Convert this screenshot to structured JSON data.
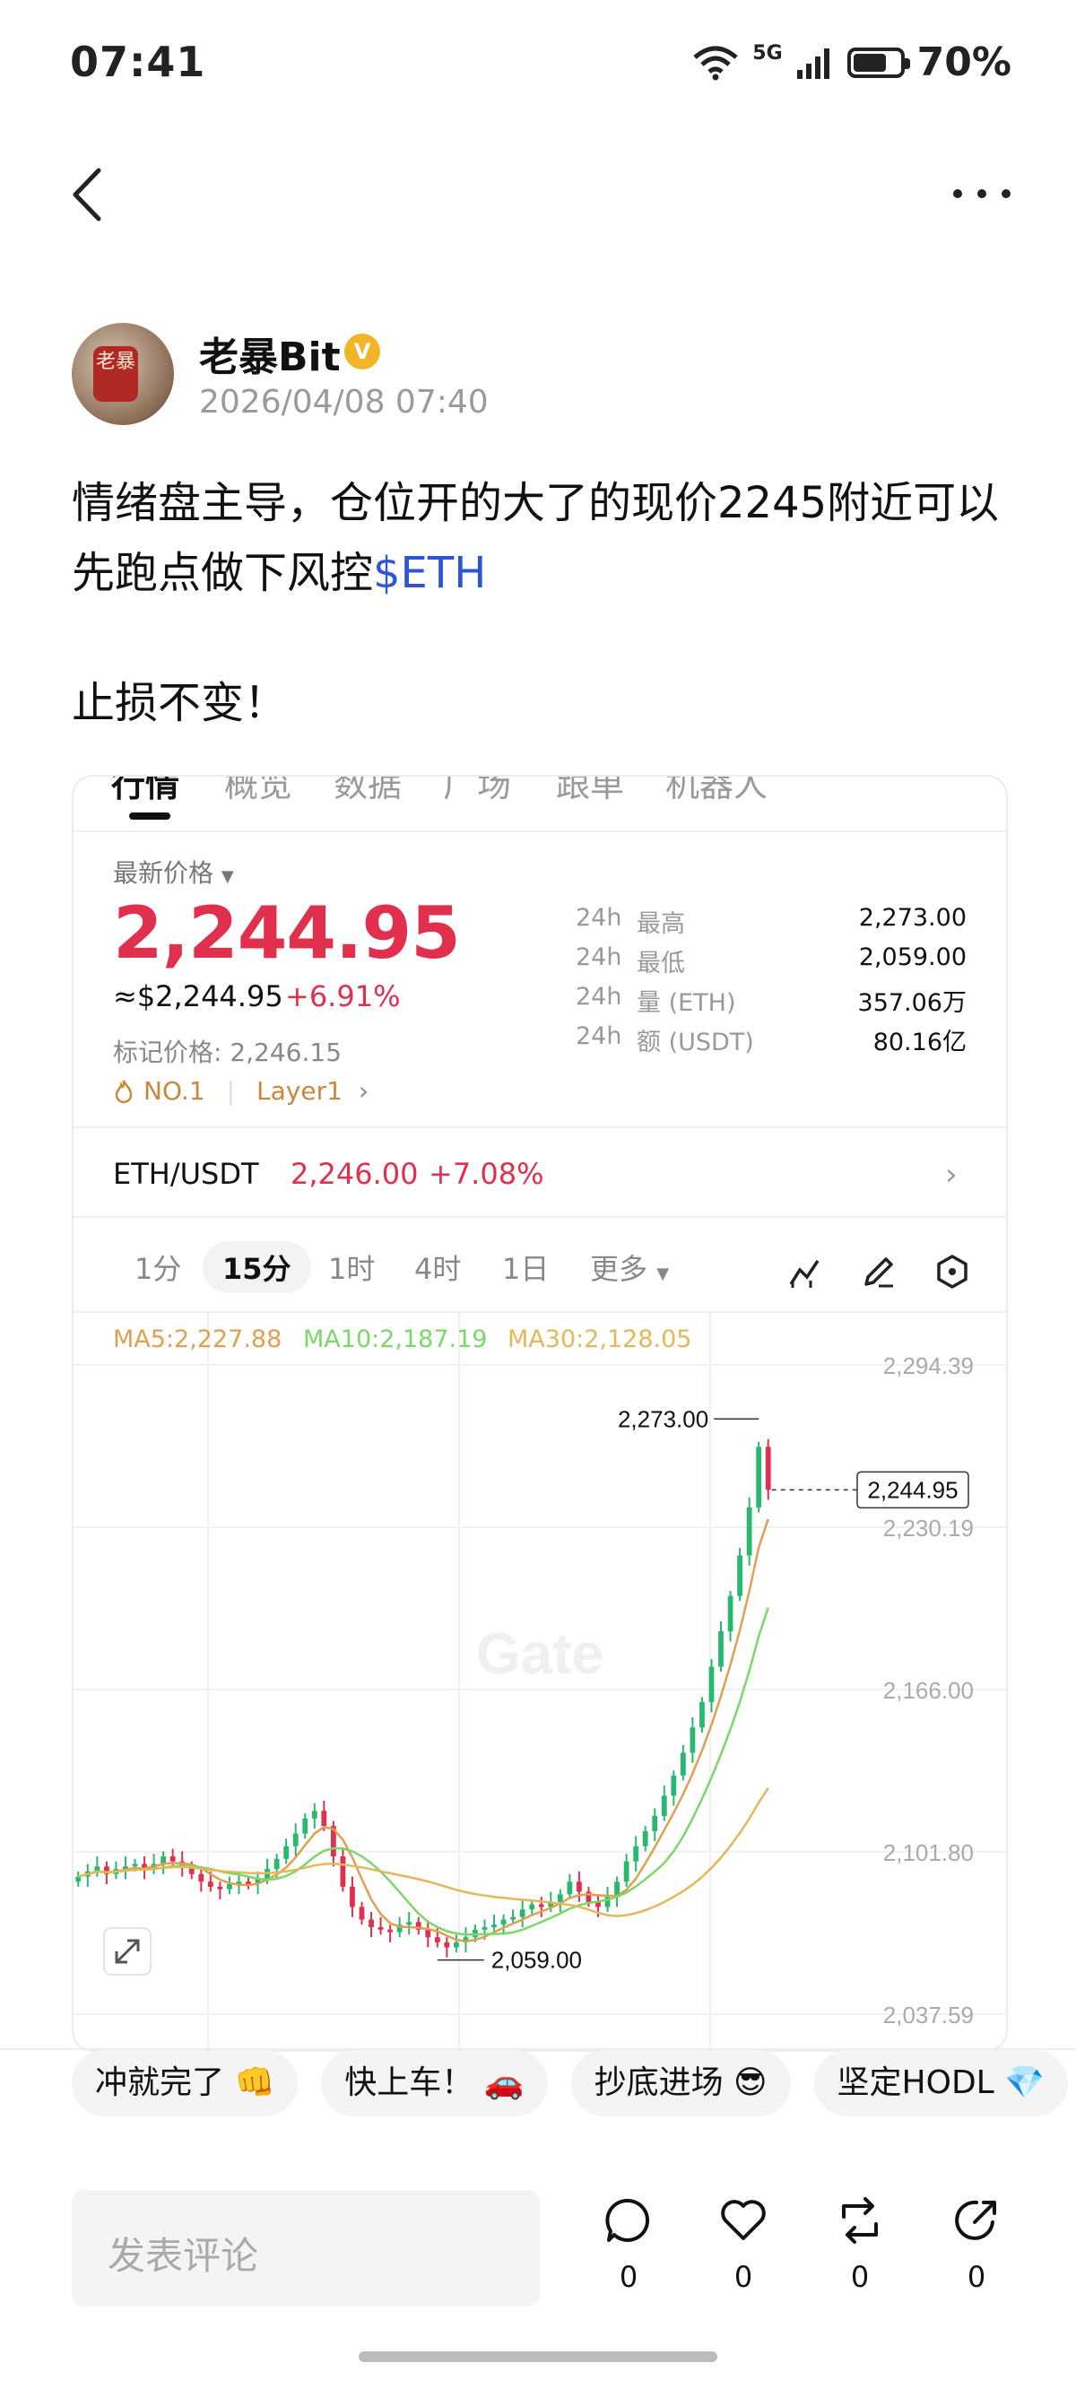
{
  "status_bar": {
    "time": "07:41",
    "signal_label": "5G",
    "battery_text": "70%",
    "battery_level": 0.7
  },
  "author": {
    "name": "老暴Bit",
    "avatar_text": "老暴",
    "timestamp": "2026/04/08 07:40",
    "verified_mark": "V"
  },
  "post": {
    "line1": "情绪盘主导，仓位开的大了的现价2245附近可以",
    "line2": "先跑点做下风控",
    "tag": "$ETH",
    "line3": "止损不变！"
  },
  "card": {
    "tabs": [
      "行情",
      "概览",
      "数据",
      "广场",
      "跟单",
      "机器人"
    ],
    "latest_label": "最新价格",
    "price": "2,244.95",
    "usd_price": "≈$2,244.95",
    "change_pct": "+6.91%",
    "mark_price": "标记价格: 2,246.15",
    "rank": "NO.1",
    "category": "Layer1",
    "stats": [
      {
        "k1": "24h",
        "k2": "最高",
        "v": "2,273.00"
      },
      {
        "k1": "24h",
        "k2": "最低",
        "v": "2,059.00"
      },
      {
        "k1": "24h",
        "k2": "量 (ETH)",
        "v": "357.06万"
      },
      {
        "k1": "24h",
        "k2": "额 (USDT)",
        "v": "80.16亿"
      }
    ],
    "pair": "ETH/USDT",
    "pair_price": "2,246.00",
    "pair_change": "+7.08%",
    "intervals": [
      "1分",
      "15分",
      "1时",
      "4时",
      "1日",
      "更多"
    ],
    "active_interval": "15分"
  },
  "chart_data": {
    "type": "candlestick",
    "ma_labels": [
      "MA5:2,227.88",
      "MA10:2,187.19",
      "MA30:2,128.05"
    ],
    "y_ticks": [
      "2,294.39",
      "2,230.19",
      "2,166.00",
      "2,101.80",
      "2,037.59"
    ],
    "ylim": [
      2037.59,
      2294.39
    ],
    "high_label": "2,273.00",
    "low_label": "2,059.00",
    "current_label": "2,244.95",
    "watermark": "Gate",
    "colors": {
      "up": "#28b870",
      "down": "#e0304e",
      "ma5": "#e0a050",
      "ma10": "#7ad86a",
      "ma30": "#e2b85a"
    },
    "close": [
      2092,
      2094,
      2096,
      2093,
      2095,
      2096,
      2097,
      2095,
      2097,
      2100,
      2098,
      2096,
      2093,
      2090,
      2088,
      2087,
      2089,
      2090,
      2089,
      2091,
      2095,
      2099,
      2104,
      2109,
      2115,
      2118,
      2112,
      2100,
      2088,
      2080,
      2075,
      2072,
      2071,
      2070,
      2073,
      2074,
      2071,
      2068,
      2066,
      2064,
      2066,
      2068,
      2071,
      2072,
      2073,
      2075,
      2076,
      2079,
      2081,
      2080,
      2082,
      2085,
      2090,
      2086,
      2082,
      2080,
      2084,
      2090,
      2098,
      2104,
      2110,
      2116,
      2124,
      2132,
      2141,
      2151,
      2161,
      2175,
      2189,
      2203,
      2219,
      2238,
      2262,
      2245
    ]
  },
  "reactions": [
    "冲就完了 👊",
    "快上车！ 🚗",
    "抄底进场 😎",
    "坚定HODL 💎"
  ],
  "comment_placeholder": "发表评论",
  "actions": [
    {
      "icon": "comment-icon",
      "count": "0"
    },
    {
      "icon": "heart-icon",
      "count": "0"
    },
    {
      "icon": "repost-icon",
      "count": "0"
    },
    {
      "icon": "share-icon",
      "count": "0"
    }
  ]
}
